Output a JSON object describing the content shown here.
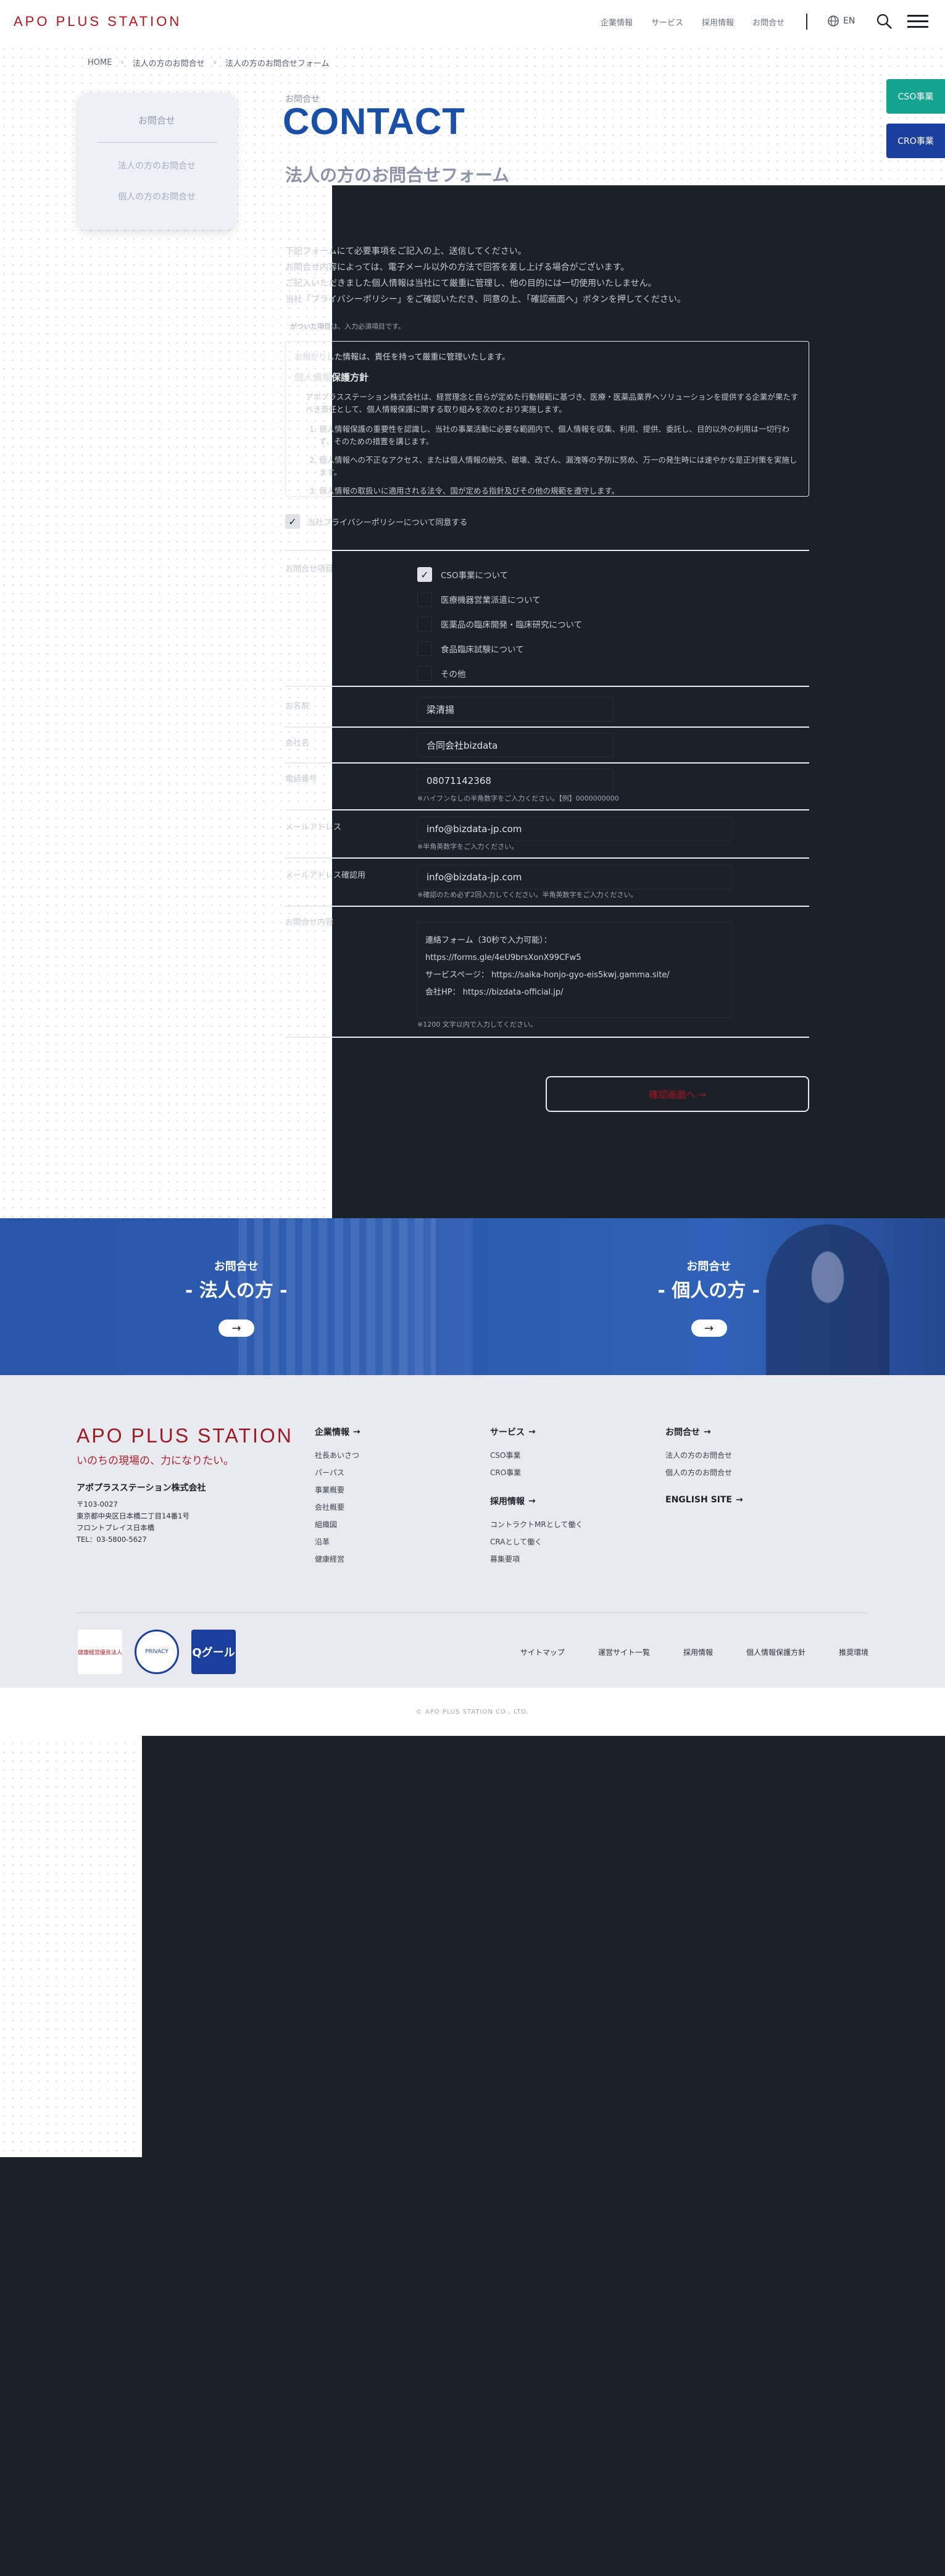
{
  "header": {
    "logo": "APO PLUS STATION",
    "nav": [
      "企業情報",
      "サービス",
      "採用情報",
      "お問合せ"
    ],
    "lang": "EN"
  },
  "breadcrumb": [
    "HOME",
    "法人の方のお問合せ",
    "法人の方のお問合せフォーム"
  ],
  "sidebar": {
    "title": "お問合せ",
    "items": [
      "法人の方のお問合せ",
      "個人の方のお問合せ"
    ]
  },
  "title": {
    "small": "お問合せ",
    "en": "CONTACT",
    "ja": "法人の方のお問合せフォーム"
  },
  "tabs": {
    "cso": "CSO事業",
    "cro": "CRO事業"
  },
  "intro": [
    "下記フォームにて必要事項をご記入の上、送信してください。",
    "お問合せ内容によっては、電子メール以外の方法で回答を差し上げる場合がございます。",
    "ご記入いただきました個人情報は当社にて厳重に管理し、他の目的には一切使用いたしません。",
    "当社「プライバシーポリシー」をご確認いただき、同意の上、「確認画面へ」ボタンを押してください。"
  ],
  "required_note": "がついた項目は、入力必須項目です。",
  "privacy": {
    "lead": "お預かりした情報は、責任を持って厳重に管理いたします。",
    "heading": "個人情報保護方針",
    "body": "アポプラスステーション株式会社は、経営理念と自らが定めた行動規範に基づき、医療・医薬品業界ヘソリューションを提供する企業が果たすべき責任として、個人情報保護に関する取り組みを次のとおり実施します。",
    "items": [
      "個人情報保護の重要性を認識し、当社の事業活動に必要な範囲内で、個人情報を収集、利用、提供、委託し、目的以外の利用は一切行わず、そのための措置を講じます。",
      "個人情報への不正なアクセス、または個人情報の紛失、破壊、改ざん、漏洩等の予防に努め、万一の発生時には速やかな是正対策を実施します。",
      "個人情報の取扱いに適用される法令、国が定める指針及びその他の規範を遵守します。"
    ]
  },
  "agree_label": "当社プライバシーポリシーについて同意する",
  "form": {
    "category_label": "お問合せ項目",
    "categories": [
      {
        "label": "CSO事業について",
        "checked": true
      },
      {
        "label": "医療機器営業派遣について",
        "checked": false
      },
      {
        "label": "医薬品の臨床開発・臨床研究について",
        "checked": false
      },
      {
        "label": "食品臨床試験について",
        "checked": false
      },
      {
        "label": "その他",
        "checked": false
      }
    ],
    "name_label": "お名前",
    "name_value": "梁清揚",
    "company_label": "会社名",
    "company_value": "合同会社bizdata",
    "phone_label": "電話番号",
    "phone_value": "08071142368",
    "phone_hint": "※ハイフンなしの半角数字をご入力ください。【例】0000000000",
    "email_label": "メールアドレス",
    "email_value": "info@bizdata-jp.com",
    "email_hint": "※半角英数字をご入力ください。",
    "email_confirm_label": "メールアドレス確認用",
    "email_confirm_value": "info@bizdata-jp.com",
    "email_confirm_hint": "※確認のため必ず2回入力してください。半角英数字をご入力ください。",
    "message_label": "お問合せ内容",
    "message_lines": [
      "連絡フォーム（30秒で入力可能）：",
      "https://forms.gle/4eU9brsXonX99CFw5",
      "サービスページ： https://saika-honjo-gyo-eis5kwj.gamma.site/",
      "会社HP： https://bizdata-official.jp/"
    ],
    "message_hint": "※1200 文字以内で入力してください。",
    "confirm_button": "確認画面へ →"
  },
  "banners": [
    {
      "small": "お問合せ",
      "big": "- 法人の方 -"
    },
    {
      "small": "お問合せ",
      "big": "- 個人の方 -"
    }
  ],
  "footer": {
    "logo": "APO PLUS STATION",
    "tagline": "いのちの現場の、力になりたい。",
    "company": "アポプラスステーション株式会社",
    "address": [
      "〒103-0027",
      "東京都中央区日本橋二丁目14番1号",
      "フロントプレイス日本橋",
      "TEL：03-5800-5627"
    ],
    "col_corporate": {
      "heading": "企業情報",
      "items": [
        "社長あいさつ",
        "パーパス",
        "事業概要",
        "会社概要",
        "組織図",
        "沿革",
        "健康経営"
      ]
    },
    "col_service": {
      "heading": "サービス",
      "items": [
        "CSO事業",
        "CRO事業"
      ],
      "heading2": "採用情報",
      "items2": [
        "コントラクトMRとして働く",
        "CRAとして働く",
        "募集要項"
      ]
    },
    "col_contact": {
      "heading": "お問合せ",
      "items": [
        "法人の方のお問合せ",
        "個人の方のお問合せ"
      ],
      "english": "ENGLISH SITE"
    },
    "badges": [
      "健康経営優良法人",
      "PRIVACY",
      "Qグール"
    ],
    "links": [
      "サイトマップ",
      "運営サイト一覧",
      "採用情報",
      "個人情報保護方針",
      "推奨環境"
    ],
    "copyright": "© APO PLUS STATION CO., LTD."
  }
}
